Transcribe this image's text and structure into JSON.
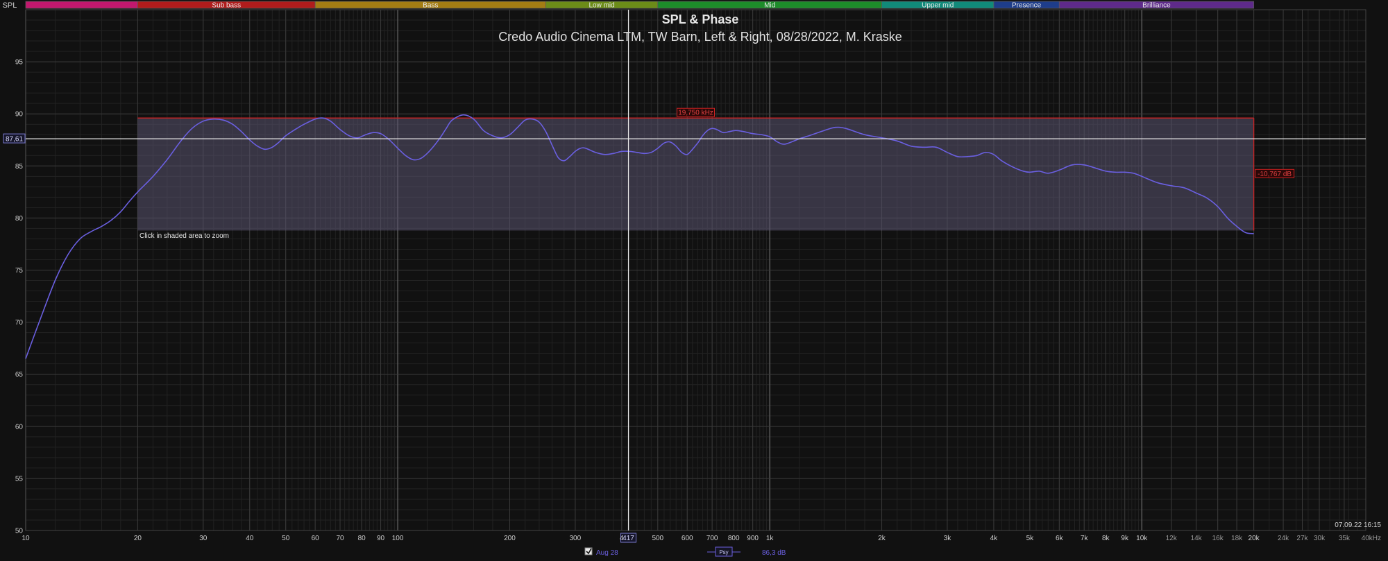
{
  "header": {
    "axis_name": "SPL",
    "title": "SPL & Phase",
    "subtitle": "Credo Audio Cinema LTM, TW Barn, Left & Right, 08/28/2022, M. Kraske"
  },
  "bands": [
    {
      "label": "",
      "from": 10,
      "to": 20,
      "color": "#c2186e"
    },
    {
      "label": "Sub bass",
      "from": 20,
      "to": 60,
      "color": "#b01c1c"
    },
    {
      "label": "Bass",
      "from": 60,
      "to": 250,
      "color": "#a47d13"
    },
    {
      "label": "Low mid",
      "from": 250,
      "to": 500,
      "color": "#6c8c18"
    },
    {
      "label": "Mid",
      "from": 500,
      "to": 2000,
      "color": "#1d8c2a"
    },
    {
      "label": "Upper mid",
      "from": 2000,
      "to": 4000,
      "color": "#118a7a"
    },
    {
      "label": "Presence",
      "from": 4000,
      "to": 6000,
      "color": "#1e3d8a"
    },
    {
      "label": "Brilliance",
      "from": 6000,
      "to": 20000,
      "color": "#5e2a8a"
    }
  ],
  "overlay": {
    "zoom_hint": "Click in shaded area to zoom",
    "width_readout": "19,750 kHz",
    "height_readout": "-10,767 dB",
    "cursor_level": "87,61",
    "cursor_freq": "417",
    "timestamp": "07.09.22 16:15"
  },
  "legend": {
    "checkbox_checked": true,
    "trace_name": "Aug 28",
    "trace_tag": "Psy",
    "value": "86,3 dB",
    "color": "#6a5fe0"
  },
  "colors": {
    "background": "#111111",
    "grid_major": "#3a3a3a",
    "grid_minor": "#222222",
    "trace": "#6a5fe0",
    "selection_fill": "#5a5470",
    "selection_border": "#cc2222"
  },
  "chart_data": {
    "type": "line",
    "title": "SPL & Phase",
    "subtitle": "Credo Audio Cinema LTM, TW Barn, Left & Right, 08/28/2022, M. Kraske",
    "xscale": "log",
    "xlim": [
      10,
      40000
    ],
    "ylim": [
      50,
      100
    ],
    "x_ticks": [
      {
        "v": 10,
        "t": "10"
      },
      {
        "v": 20,
        "t": "20"
      },
      {
        "v": 30,
        "t": "30"
      },
      {
        "v": 40,
        "t": "40"
      },
      {
        "v": 50,
        "t": "50"
      },
      {
        "v": 60,
        "t": "60"
      },
      {
        "v": 70,
        "t": "70"
      },
      {
        "v": 80,
        "t": "80"
      },
      {
        "v": 90,
        "t": "90"
      },
      {
        "v": 100,
        "t": "100"
      },
      {
        "v": 200,
        "t": "200"
      },
      {
        "v": 300,
        "t": "300"
      },
      {
        "v": 400,
        "t": "4"
      },
      {
        "v": 500,
        "t": "500"
      },
      {
        "v": 600,
        "t": "600"
      },
      {
        "v": 700,
        "t": "700"
      },
      {
        "v": 800,
        "t": "800"
      },
      {
        "v": 900,
        "t": "900"
      },
      {
        "v": 1000,
        "t": "1k"
      },
      {
        "v": 2000,
        "t": "2k"
      },
      {
        "v": 3000,
        "t": "3k"
      },
      {
        "v": 4000,
        "t": "4k"
      },
      {
        "v": 5000,
        "t": "5k"
      },
      {
        "v": 6000,
        "t": "6k"
      },
      {
        "v": 7000,
        "t": "7k"
      },
      {
        "v": 8000,
        "t": "8k"
      },
      {
        "v": 9000,
        "t": "9k"
      },
      {
        "v": 10000,
        "t": "10k"
      },
      {
        "v": 12000,
        "t": "12k"
      },
      {
        "v": 14000,
        "t": "14k"
      },
      {
        "v": 16000,
        "t": "16k"
      },
      {
        "v": 18000,
        "t": "18k"
      },
      {
        "v": 20000,
        "t": "20k"
      },
      {
        "v": 24000,
        "t": "24k"
      },
      {
        "v": 27000,
        "t": "27k"
      },
      {
        "v": 30000,
        "t": "30k"
      },
      {
        "v": 35000,
        "t": "35k"
      },
      {
        "v": 40000,
        "t": "40kHz"
      }
    ],
    "y_ticks": [
      50,
      55,
      60,
      65,
      70,
      75,
      80,
      85,
      90,
      95
    ],
    "selection": {
      "x": [
        20,
        20000
      ],
      "y": [
        78.8,
        89.6
      ]
    },
    "cursor": {
      "x": 417,
      "y": 87.61
    },
    "series": [
      {
        "name": "Aug 28",
        "x": [
          10,
          11,
          12,
          13,
          14,
          15,
          16,
          17,
          18,
          19,
          20,
          22,
          24,
          26,
          28,
          30,
          32,
          34,
          36,
          38,
          40,
          42,
          44,
          46,
          48,
          50,
          53,
          56,
          60,
          63,
          66,
          70,
          74,
          78,
          82,
          86,
          90,
          95,
          100,
          105,
          110,
          115,
          120,
          125,
          130,
          135,
          140,
          150,
          160,
          170,
          180,
          190,
          200,
          210,
          220,
          230,
          240,
          250,
          260,
          270,
          280,
          290,
          300,
          310,
          320,
          340,
          360,
          380,
          400,
          420,
          440,
          460,
          480,
          500,
          520,
          540,
          560,
          580,
          600,
          620,
          640,
          660,
          680,
          700,
          720,
          750,
          780,
          810,
          850,
          900,
          950,
          1000,
          1050,
          1100,
          1200,
          1300,
          1400,
          1500,
          1600,
          1800,
          2000,
          2200,
          2400,
          2600,
          2800,
          3000,
          3200,
          3400,
          3600,
          3800,
          4000,
          4200,
          4500,
          4800,
          5000,
          5300,
          5600,
          6000,
          6500,
          7000,
          7500,
          8000,
          8500,
          9000,
          9500,
          10000,
          11000,
          12000,
          13000,
          14000,
          15000,
          16000,
          17000,
          18000,
          19000,
          20000
        ],
        "y": [
          66.5,
          70.5,
          74,
          76.5,
          78,
          78.7,
          79.2,
          79.8,
          80.6,
          81.6,
          82.5,
          84,
          85.6,
          87.3,
          88.6,
          89.3,
          89.5,
          89.4,
          89,
          88.3,
          87.5,
          86.9,
          86.6,
          86.8,
          87.3,
          87.9,
          88.5,
          89,
          89.5,
          89.6,
          89.3,
          88.5,
          87.9,
          87.7,
          88,
          88.2,
          88.1,
          87.5,
          86.7,
          86,
          85.6,
          85.7,
          86.2,
          86.9,
          87.7,
          88.6,
          89.4,
          89.9,
          89.5,
          88.4,
          87.9,
          87.7,
          88,
          88.7,
          89.4,
          89.5,
          89.2,
          88.3,
          87,
          85.8,
          85.5,
          85.9,
          86.4,
          86.7,
          86.7,
          86.3,
          86.1,
          86.2,
          86.4,
          86.4,
          86.3,
          86.2,
          86.3,
          86.7,
          87.2,
          87.3,
          86.9,
          86.3,
          86.1,
          86.6,
          87.2,
          87.9,
          88.4,
          88.6,
          88.5,
          88.2,
          88.3,
          88.4,
          88.3,
          88.1,
          88,
          87.8,
          87.3,
          87.1,
          87.6,
          88,
          88.4,
          88.7,
          88.6,
          88,
          87.7,
          87.4,
          86.9,
          86.8,
          86.8,
          86.3,
          85.9,
          85.9,
          86,
          86.3,
          86.1,
          85.5,
          84.9,
          84.5,
          84.4,
          84.5,
          84.3,
          84.6,
          85.1,
          85.1,
          84.8,
          84.5,
          84.4,
          84.4,
          84.3,
          84,
          83.4,
          83.1,
          82.9,
          82.4,
          81.9,
          81.1,
          80,
          79.2,
          78.6,
          78.5
        ]
      }
    ]
  }
}
